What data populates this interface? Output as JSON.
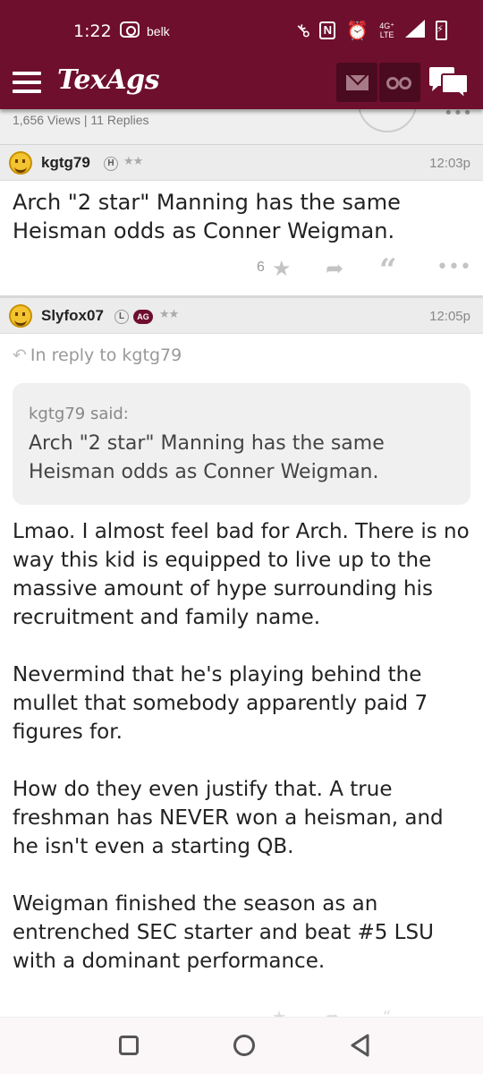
{
  "status": {
    "time": "1:22",
    "carrier_label": "belk",
    "network_top": "4G⁺",
    "network_bottom": "LTE",
    "nfc_label": "N"
  },
  "header": {
    "logo": "TexAgs"
  },
  "thread": {
    "stats": "1,656 Views | 11 Replies"
  },
  "posts": [
    {
      "username": "kgtg79",
      "badges": [
        "H"
      ],
      "stars": "★★",
      "time": "12:03p",
      "text": "Arch \"2 star\" Manning has the same Heisman odds as Conner Weigman.",
      "likes": "6"
    },
    {
      "username": "Slyfox07",
      "badges": [
        "L",
        "AG"
      ],
      "stars": "★★",
      "time": "12:05p",
      "in_reply_to": "In reply to kgtg79",
      "quote": {
        "author_line": "kgtg79 said:",
        "text": "Arch \"2 star\" Manning has the same Heisman odds as Conner Weigman."
      },
      "paragraphs": [
        "Lmao. I almost feel bad for Arch. There is no way this kid is equipped to live up to the massive amount of hype surrounding his recruitment and family name.",
        "Nevermind that he's playing behind the mullet that somebody apparently paid 7 figures for.",
        "How do they even justify that. A true freshman has NEVER won a heisman, and he isn't even a starting QB.",
        "Weigman finished the season as an entrenched SEC starter and beat #5 LSU with a dominant performance."
      ]
    }
  ],
  "colors": {
    "brand": "#6e0f2e",
    "brand_dark": "#4a0a1f",
    "header_bg": "#ececec"
  },
  "icons": {
    "menu": "hamburger-icon",
    "messages": "envelope-icon",
    "watch": "binoculars-icon",
    "chat": "chat-bubbles-icon",
    "like": "star-icon",
    "reply": "reply-arrow-icon",
    "quote": "quote-icon",
    "more": "more-dots-icon"
  }
}
